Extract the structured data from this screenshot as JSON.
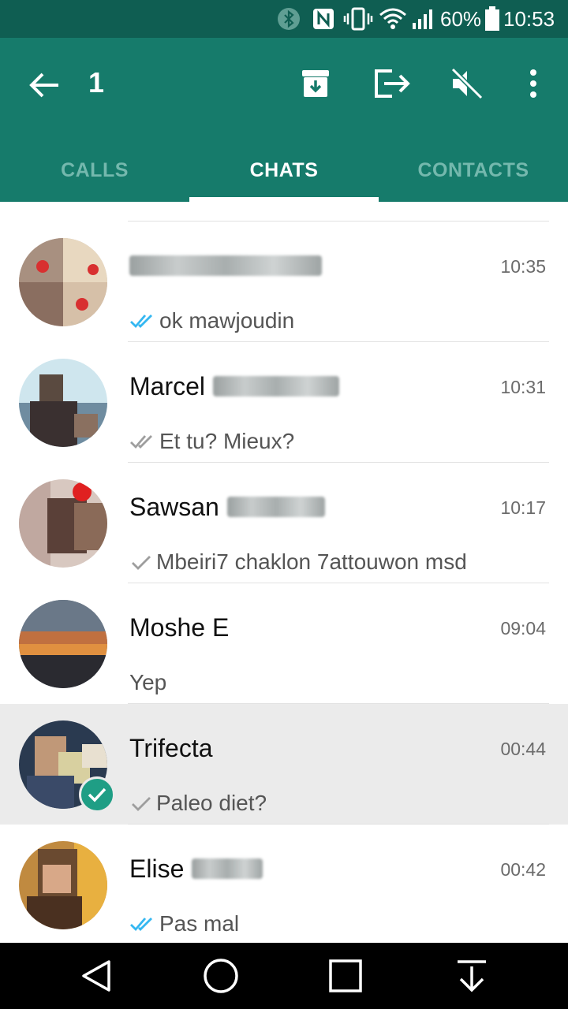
{
  "status_bar": {
    "battery_percent": "60%",
    "time": "10:53",
    "icons": [
      "bluetooth-icon",
      "nfc-icon",
      "vibrate-icon",
      "wifi-icon",
      "signal-icon",
      "battery-icon"
    ]
  },
  "app_bar": {
    "selected_count": "1",
    "actions": [
      "back-arrow-icon",
      "archive-icon",
      "exit-group-icon",
      "mute-icon",
      "more-options-icon"
    ],
    "bg_color": "#167b6b"
  },
  "tabs": [
    {
      "label": "CALLS",
      "active": false
    },
    {
      "label": "CHATS",
      "active": true
    },
    {
      "label": "CONTACTS",
      "active": false
    }
  ],
  "chats": [
    {
      "name": "",
      "name_obscured": true,
      "time": "10:35",
      "message": "ok mawjoudin",
      "ticks": "read",
      "selected": false
    },
    {
      "name": "Marcel",
      "name_obscured": true,
      "time": "10:31",
      "message": "Et tu? Mieux?",
      "ticks": "delivered",
      "selected": false
    },
    {
      "name": "Sawsan",
      "name_obscured": true,
      "time": "10:17",
      "message": "Mbeiri7 chaklon 7attouwon msd",
      "ticks": "sent",
      "selected": false
    },
    {
      "name": "Moshe E",
      "name_obscured": false,
      "time": "09:04",
      "message": "Yep",
      "ticks": "none",
      "selected": false
    },
    {
      "name": "Trifecta",
      "name_obscured": false,
      "time": "00:44",
      "message": "Paleo diet?",
      "ticks": "sent",
      "selected": true
    },
    {
      "name": "Elise",
      "name_obscured": true,
      "time": "00:42",
      "message": "Pas mal",
      "ticks": "read",
      "selected": false
    }
  ],
  "colors": {
    "read_tick": "#34b7f1",
    "grey_tick": "#9e9e9e",
    "selected_badge": "#1f9e85"
  },
  "nav_bar": {
    "buttons": [
      "back-triangle-icon",
      "home-circle-icon",
      "recents-square-icon",
      "hide-keyboard-icon"
    ]
  }
}
